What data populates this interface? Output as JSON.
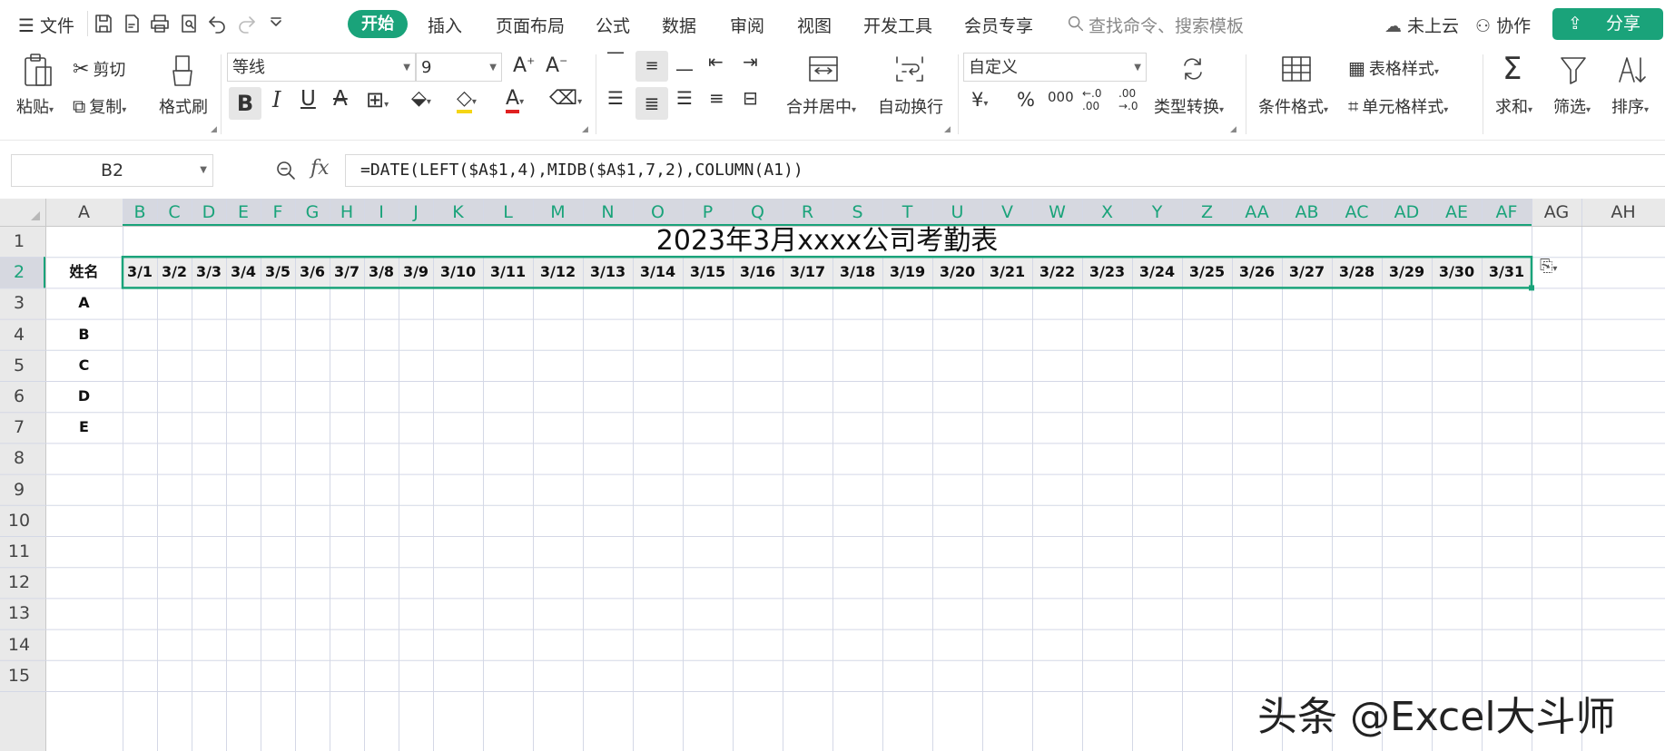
{
  "menu": {
    "file": "文件",
    "tabs": [
      "开始",
      "插入",
      "页面布局",
      "公式",
      "数据",
      "审阅",
      "视图",
      "开发工具",
      "会员专享"
    ],
    "search_placeholder": "查找命令、搜索模板",
    "cloud": "未上云",
    "collab": "协作",
    "share": "分享"
  },
  "ribbon": {
    "paste": "粘贴",
    "cut": "剪切",
    "copy": "复制",
    "format_painter": "格式刷",
    "font_name": "等线",
    "font_size": "9",
    "merge_center": "合并居中",
    "wrap": "自动换行",
    "number_format": "自定义",
    "convert": "类型转换",
    "cond_format": "条件格式",
    "table_style": "表格样式",
    "cell_style": "单元格样式",
    "sum": "求和",
    "filter": "筛选",
    "sort": "排序"
  },
  "formula_bar": {
    "name_box": "B2",
    "fx": "fx",
    "formula": "=DATE(LEFT($A$1,4),MIDB($A$1,7,2),COLUMN(A1))"
  },
  "sheet": {
    "columns": [
      "A",
      "B",
      "C",
      "D",
      "E",
      "F",
      "G",
      "H",
      "I",
      "J",
      "K",
      "L",
      "M",
      "N",
      "O",
      "P",
      "Q",
      "R",
      "S",
      "T",
      "U",
      "V",
      "W",
      "X",
      "Y",
      "Z",
      "AA",
      "AB",
      "AC",
      "AD",
      "AE",
      "AF",
      "AG",
      "AH"
    ],
    "rows": [
      "1",
      "2",
      "3",
      "4",
      "5",
      "6",
      "7",
      "8",
      "9",
      "10",
      "11",
      "12",
      "13",
      "14",
      "15"
    ],
    "title": "2023年3月xxxx公司考勤表",
    "name_header": "姓名",
    "dates": [
      "3/1",
      "3/2",
      "3/3",
      "3/4",
      "3/5",
      "3/6",
      "3/7",
      "3/8",
      "3/9",
      "3/10",
      "3/11",
      "3/12",
      "3/13",
      "3/14",
      "3/15",
      "3/16",
      "3/17",
      "3/18",
      "3/19",
      "3/20",
      "3/21",
      "3/22",
      "3/23",
      "3/24",
      "3/25",
      "3/26",
      "3/27",
      "3/28",
      "3/29",
      "3/30",
      "3/31"
    ],
    "names": [
      "A",
      "B",
      "C",
      "D",
      "E"
    ]
  },
  "watermark": "头条 @Excel大斗师",
  "colors": {
    "accent": "#1aa37a",
    "grid": "#d4d8e6",
    "header_bg": "#e9e9e9",
    "selected_header_bg": "#d6d8e0"
  }
}
